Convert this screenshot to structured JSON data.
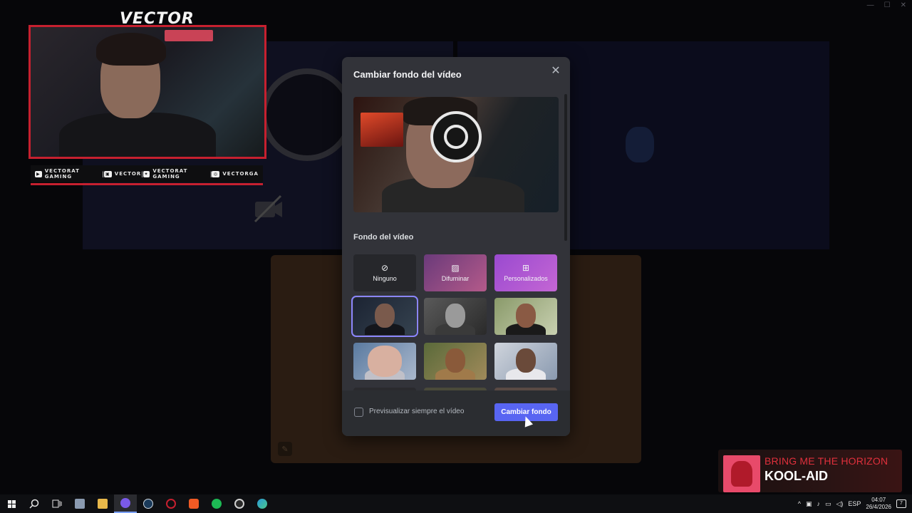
{
  "window": {
    "controls": [
      "—",
      "☐",
      "✕"
    ]
  },
  "overlay": {
    "title": "VECTOR",
    "social": [
      {
        "icon": "youtube-icon",
        "label": "VECTORAT GAMING"
      },
      {
        "icon": "twitch-icon",
        "label": "VECTOR"
      },
      {
        "icon": "twitter-icon",
        "label": "VECTORAT GAMING"
      },
      {
        "icon": "instagram-icon",
        "label": "VECTORGA"
      }
    ],
    "separator": "|"
  },
  "modal": {
    "title": "Cambiar fondo del vídeo",
    "close_glyph": "✕",
    "section_label": "Fondo del vídeo",
    "options": {
      "none": {
        "label": "Ninguno",
        "glyph": "⊘"
      },
      "blur": {
        "label": "Difuminar",
        "glyph": "▨"
      },
      "custom": {
        "label": "Personalizados",
        "glyph": "⊞"
      }
    },
    "selected_thumbnail": 1,
    "checkbox_label": "Previsualizar siempre el vídeo",
    "checkbox_checked": false,
    "apply_label": "Cambiar fondo"
  },
  "now_playing": {
    "artist": "BRING ME THE HORIZON",
    "song": "KOOL-AID"
  },
  "taskbar": {
    "language": "ESP",
    "time": "04:07",
    "date": "26/4/2026",
    "notification_count": "7",
    "tray_up_arrow": "^"
  },
  "colors": {
    "accent": "#5865f2",
    "overlay_red": "#c6202f",
    "modal_bg": "#323339",
    "artist_red": "#e0303c"
  }
}
